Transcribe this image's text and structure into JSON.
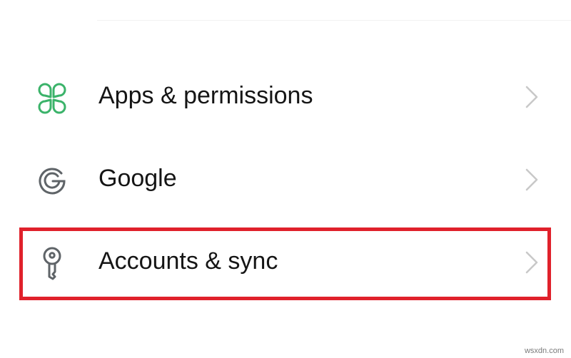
{
  "settings": {
    "items": [
      {
        "label": "Apps & permissions",
        "icon": "apps-grid-icon",
        "icon_color": "#3bb36a"
      },
      {
        "label": "Google",
        "icon": "google-g-icon",
        "icon_color": "#5f6468"
      },
      {
        "label": "Accounts & sync",
        "icon": "key-icon",
        "icon_color": "#5f6468"
      }
    ],
    "chevron_icon": "chevron-right-icon",
    "chevron_color": "#c8c8c8"
  },
  "highlight": {
    "target": "Accounts & sync",
    "color": "#e0212b"
  },
  "watermark": "wsxdn.com"
}
